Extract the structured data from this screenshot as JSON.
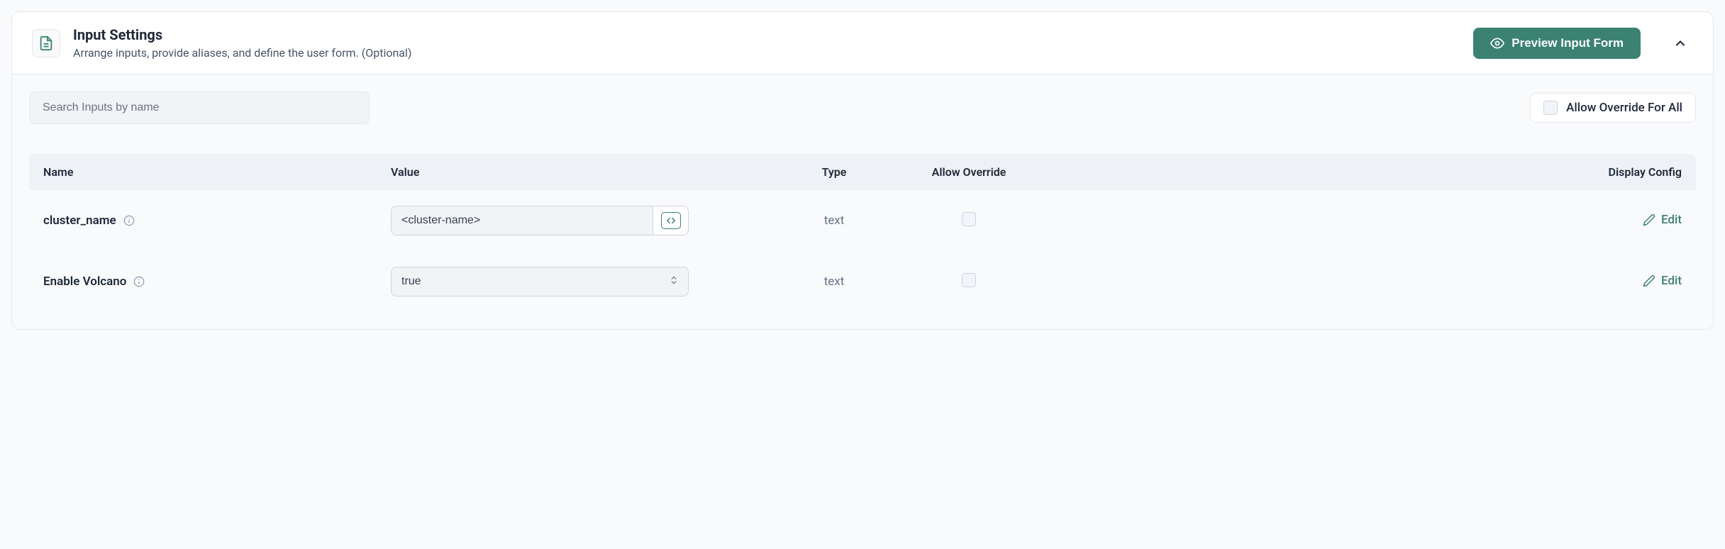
{
  "header": {
    "title": "Input Settings",
    "subtitle": "Arrange inputs, provide aliases, and define the user form. (Optional)",
    "preview_label": "Preview Input Form"
  },
  "controls": {
    "search_placeholder": "Search Inputs by name",
    "override_all_label": "Allow Override For All"
  },
  "table": {
    "headers": {
      "name": "Name",
      "value": "Value",
      "type": "Type",
      "allow": "Allow Override",
      "config": "Display Config"
    },
    "rows": [
      {
        "name": "cluster_name",
        "value": "<cluster-name>",
        "type": "text",
        "edit_label": "Edit",
        "value_kind": "text"
      },
      {
        "name": "Enable Volcano",
        "value": "true",
        "type": "text",
        "edit_label": "Edit",
        "value_kind": "select"
      }
    ]
  }
}
